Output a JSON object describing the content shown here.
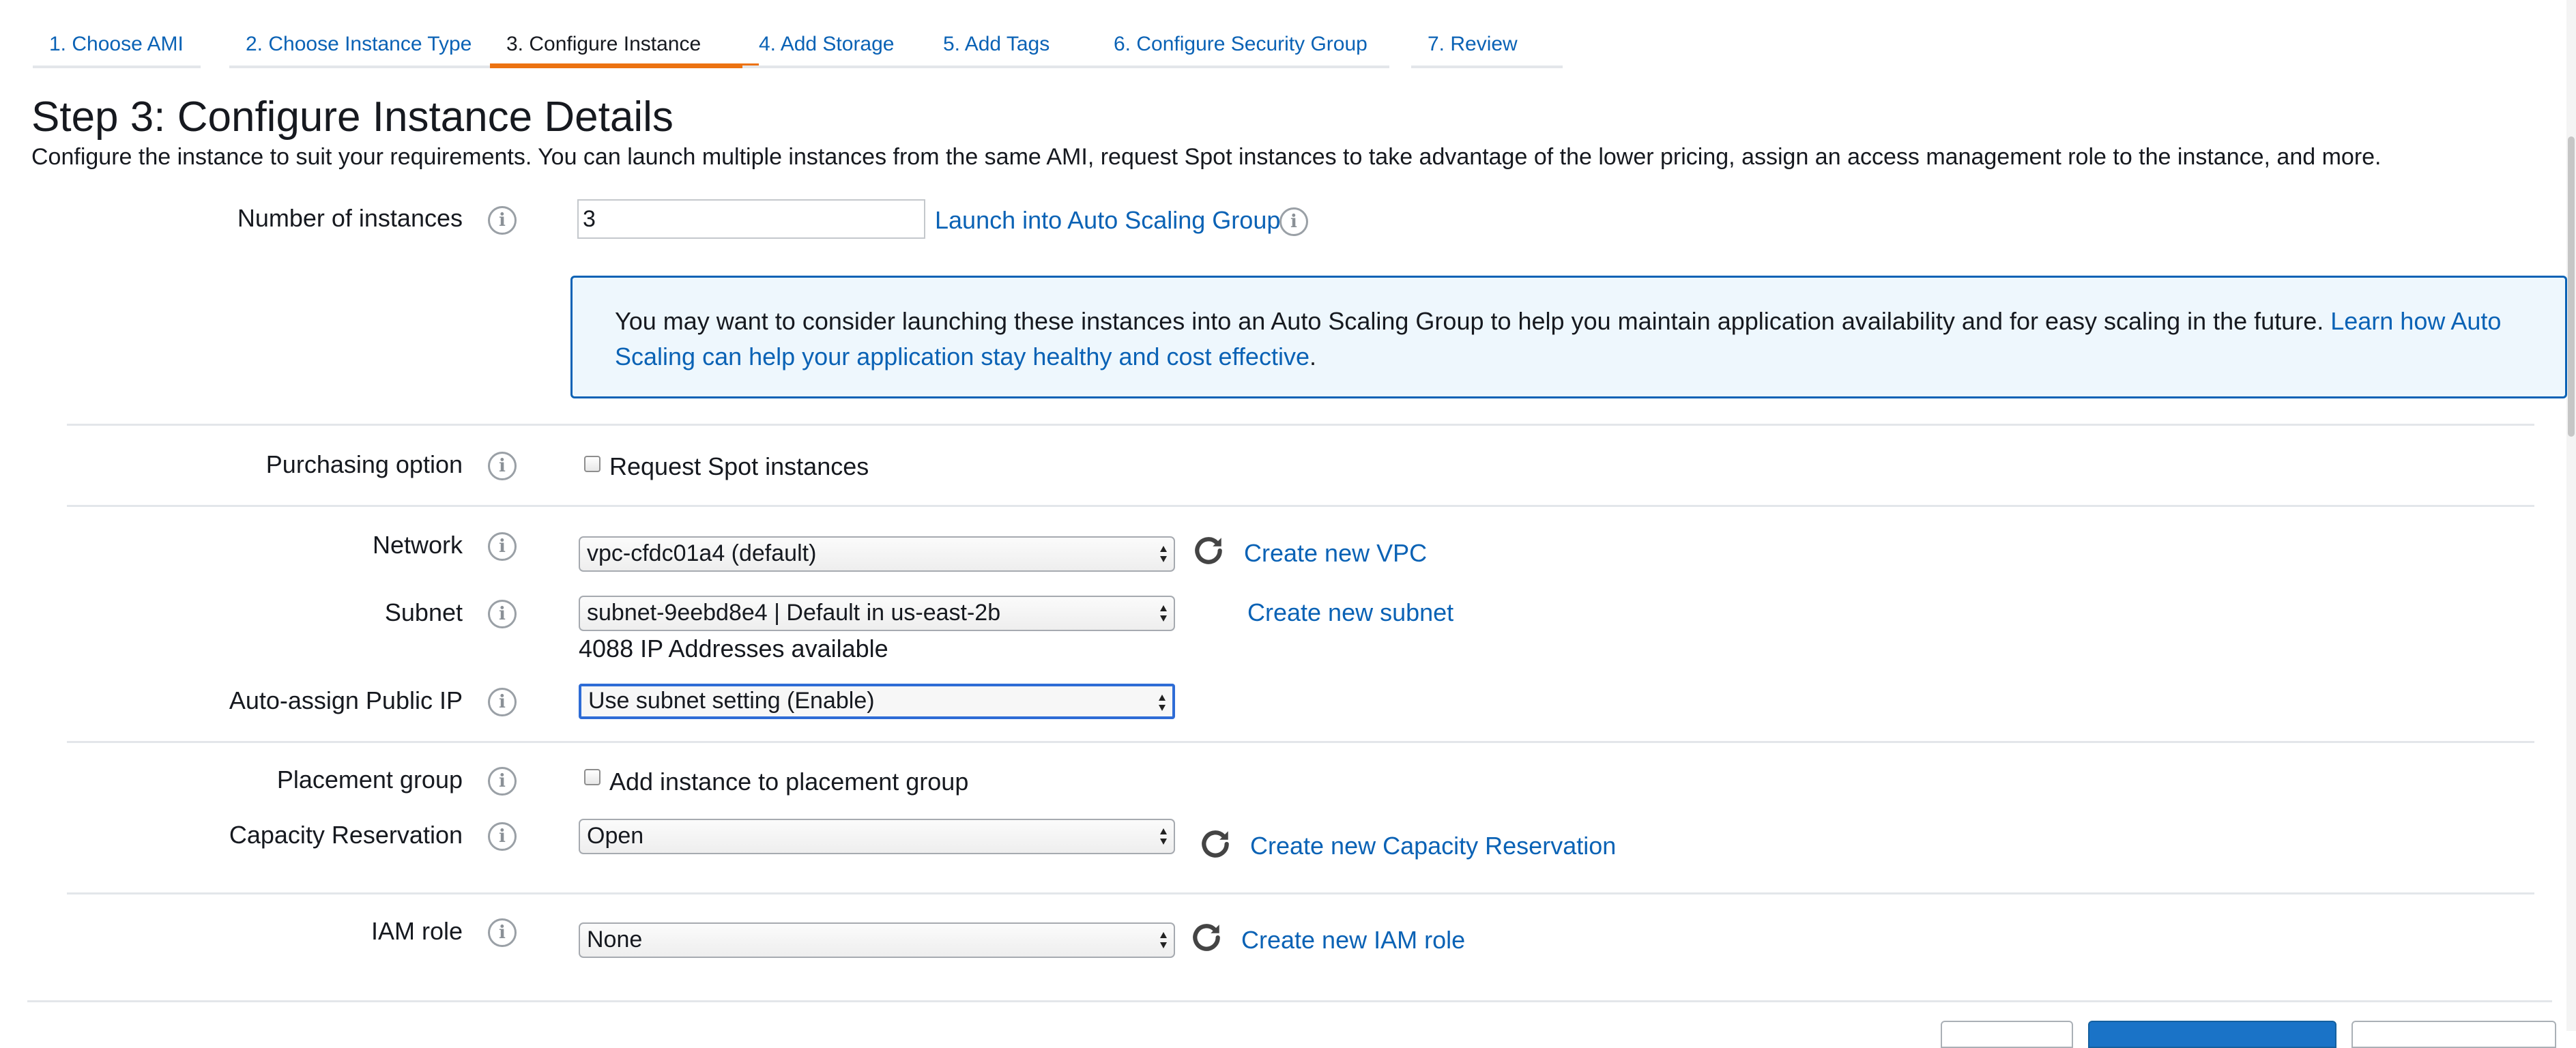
{
  "tabs": [
    {
      "label": "1. Choose AMI",
      "active": false
    },
    {
      "label": "2. Choose Instance Type",
      "active": false
    },
    {
      "label": "3. Configure Instance",
      "active": true
    },
    {
      "label": "4. Add Storage",
      "active": false
    },
    {
      "label": "5. Add Tags",
      "active": false
    },
    {
      "label": "6. Configure Security Group",
      "active": false
    },
    {
      "label": "7. Review",
      "active": false
    }
  ],
  "page": {
    "title": "Step 3: Configure Instance Details",
    "description": "Configure the instance to suit your requirements. You can launch multiple instances from the same AMI, request Spot instances to take advantage of the lower pricing, assign an access management role to the instance, and more."
  },
  "fields": {
    "num_instances": {
      "label": "Number of instances",
      "value": "3",
      "link": "Launch into Auto Scaling Group"
    },
    "autoscaling_alert": {
      "text": "You may want to consider launching these instances into an Auto Scaling Group to help you maintain application availability and for easy scaling in the future. ",
      "link": "Learn how Auto Scaling can help your application stay healthy and cost effective",
      "suffix": "."
    },
    "purchasing": {
      "label": "Purchasing option",
      "checkbox_label": "Request Spot instances",
      "checked": false
    },
    "network": {
      "label": "Network",
      "value": "vpc-cfdc01a4 (default)",
      "link": "Create new VPC"
    },
    "subnet": {
      "label": "Subnet",
      "value": "subnet-9eebd8e4 | Default in us-east-2b",
      "link": "Create new subnet",
      "note": "4088 IP Addresses available"
    },
    "public_ip": {
      "label": "Auto-assign Public IP",
      "value": "Use subnet setting (Enable)"
    },
    "placement": {
      "label": "Placement group",
      "checkbox_label": "Add instance to placement group",
      "checked": false
    },
    "capacity": {
      "label": "Capacity Reservation",
      "value": "Open",
      "link": "Create new Capacity Reservation"
    },
    "iam": {
      "label": "IAM role",
      "value": "None",
      "link": "Create new IAM role"
    }
  },
  "icons": {
    "info": "info-icon",
    "refresh": "refresh-icon",
    "select_arrows": "updown-arrows-icon"
  },
  "colors": {
    "link": "#0a62b5",
    "active_tab": "#ec7211",
    "alert_bg": "#eef7fd",
    "focus": "#2e6cd6",
    "primary_button": "#1a73c7"
  }
}
